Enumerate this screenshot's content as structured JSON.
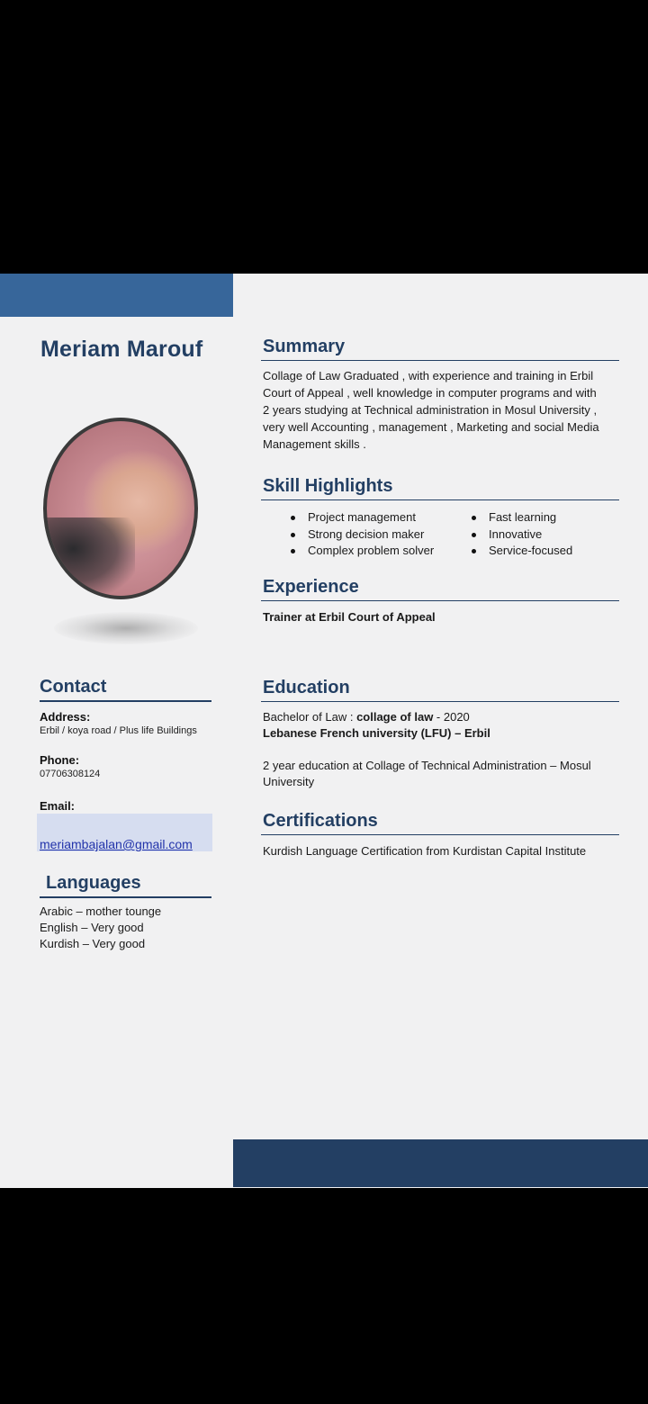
{
  "name": "Meriam Marouf",
  "left": {
    "contact_heading": "Contact",
    "address_label": "Address:",
    "address_value": "Erbil / koya road / Plus life Buildings",
    "phone_label": "Phone:",
    "phone_value": "07706308124",
    "email_label": "Email:",
    "email_value": "meriambajalan@gmail.com",
    "languages_heading": "Languages",
    "languages": [
      "Arabic – mother tounge",
      "English – Very good",
      "Kurdish – Very good"
    ]
  },
  "summary": {
    "heading": "Summary",
    "lines": [
      "Collage of Law Graduated , with experience and training in Erbil",
      "Court of Appeal , well knowledge  in computer programs and with",
      "2 years studying at Technical administration in Mosul University ,",
      "very well Accounting , management , Marketing and social Media",
      "Management skills ."
    ]
  },
  "skills": {
    "heading": "Skill Highlights",
    "col1": [
      "Project management",
      "Strong decision maker",
      "Complex problem solver"
    ],
    "col2": [
      "Fast learning",
      "Innovative",
      "Service-focused"
    ]
  },
  "experience": {
    "heading": "Experience",
    "item": "Trainer at Erbil Court  of Appeal"
  },
  "education": {
    "heading": "Education",
    "degree_prefix": "Bachelor  of Law : ",
    "degree_bold": "collage of law",
    "degree_suffix": " - 2020",
    "university": "Lebanese French university (LFU) – Erbil",
    "line2a": "2 year education at Collage of Technical Administration – Mosul",
    "line2b": "University"
  },
  "certifications": {
    "heading": "Certifications",
    "item": "Kurdish Language Certification from Kurdistan Capital Institute"
  },
  "colors": {
    "navy": "#233f63",
    "top_bar": "#37669a",
    "page_bg": "#f1f1f2",
    "email_highlight": "#d6ddf0"
  }
}
